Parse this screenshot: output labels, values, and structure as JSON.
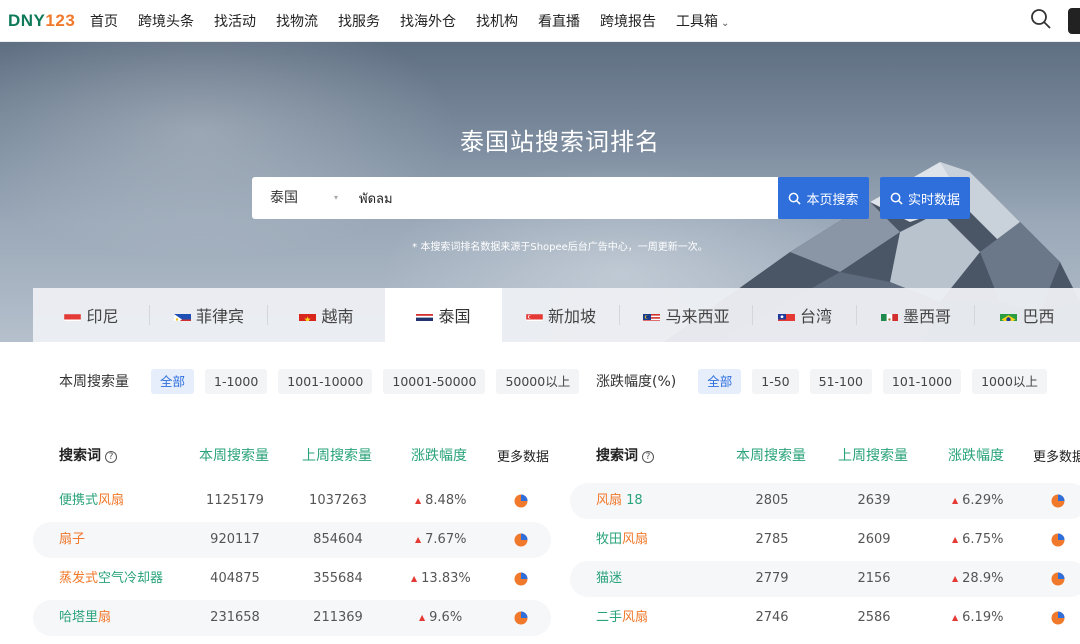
{
  "logo": {
    "part1": "DNY",
    "part2": "123"
  },
  "nav": [
    "首页",
    "跨境头条",
    "找活动",
    "找物流",
    "找服务",
    "找海外仓",
    "找机构",
    "看直播",
    "跨境报告",
    "工具箱"
  ],
  "hero": {
    "title": "泰国站搜索词排名",
    "country": "泰国",
    "query": "พัดลม",
    "btn_page": "本页搜索",
    "btn_realtime": "实时数据",
    "note": "* 本搜索词排名数据来源于Shopee后台广告中心，一周更新一次。"
  },
  "tabs": [
    "印尼",
    "菲律宾",
    "越南",
    "泰国",
    "新加坡",
    "马来西亚",
    "台湾",
    "墨西哥",
    "巴西"
  ],
  "active_tab": "泰国",
  "filters": {
    "volume": {
      "label": "本周搜索量",
      "chips": [
        "全部",
        "1-1000",
        "1001-10000",
        "10001-50000",
        "50000以上"
      ]
    },
    "change": {
      "label": "涨跌幅度(%)",
      "chips": [
        "全部",
        "1-50",
        "51-100",
        "101-1000",
        "1000以上"
      ]
    }
  },
  "table_headers": {
    "keyword": "搜索词",
    "this_week": "本周搜索量",
    "last_week": "上周搜索量",
    "change": "涨跌幅度",
    "more": "更多数据"
  },
  "left_rows": [
    {
      "kw_a": "便携式",
      "kw_b": "风扇",
      "tw": "1125179",
      "lw": "1037263",
      "chg": "8.48%"
    },
    {
      "kw_a": "",
      "kw_b": "扇子",
      "tw": "920117",
      "lw": "854604",
      "chg": "7.67%"
    },
    {
      "kw_a": "蒸发式",
      "kw_b": "空气冷却器",
      "tw": "404875",
      "lw": "355684",
      "chg": "13.83%"
    },
    {
      "kw_a": "哈塔里",
      "kw_b": "扇",
      "tw": "231658",
      "lw": "211369",
      "chg": "9.6%"
    }
  ],
  "right_rows": [
    {
      "kw_a": "风扇",
      "kw_b": " 18",
      "tw": "2805",
      "lw": "2639",
      "chg": "6.29%"
    },
    {
      "kw_a": "牧田",
      "kw_b": "风扇",
      "tw": "2785",
      "lw": "2609",
      "chg": "6.75%"
    },
    {
      "kw_a": "猫迷",
      "kw_b": "",
      "tw": "2779",
      "lw": "2156",
      "chg": "28.9%"
    },
    {
      "kw_a": "二手",
      "kw_b": "风扇",
      "tw": "2746",
      "lw": "2586",
      "chg": "6.19%"
    }
  ],
  "colors": {
    "accent_blue": "#2f6fdc",
    "green": "#2aa37a",
    "orange": "#f0792b",
    "up_red": "#e53935"
  }
}
